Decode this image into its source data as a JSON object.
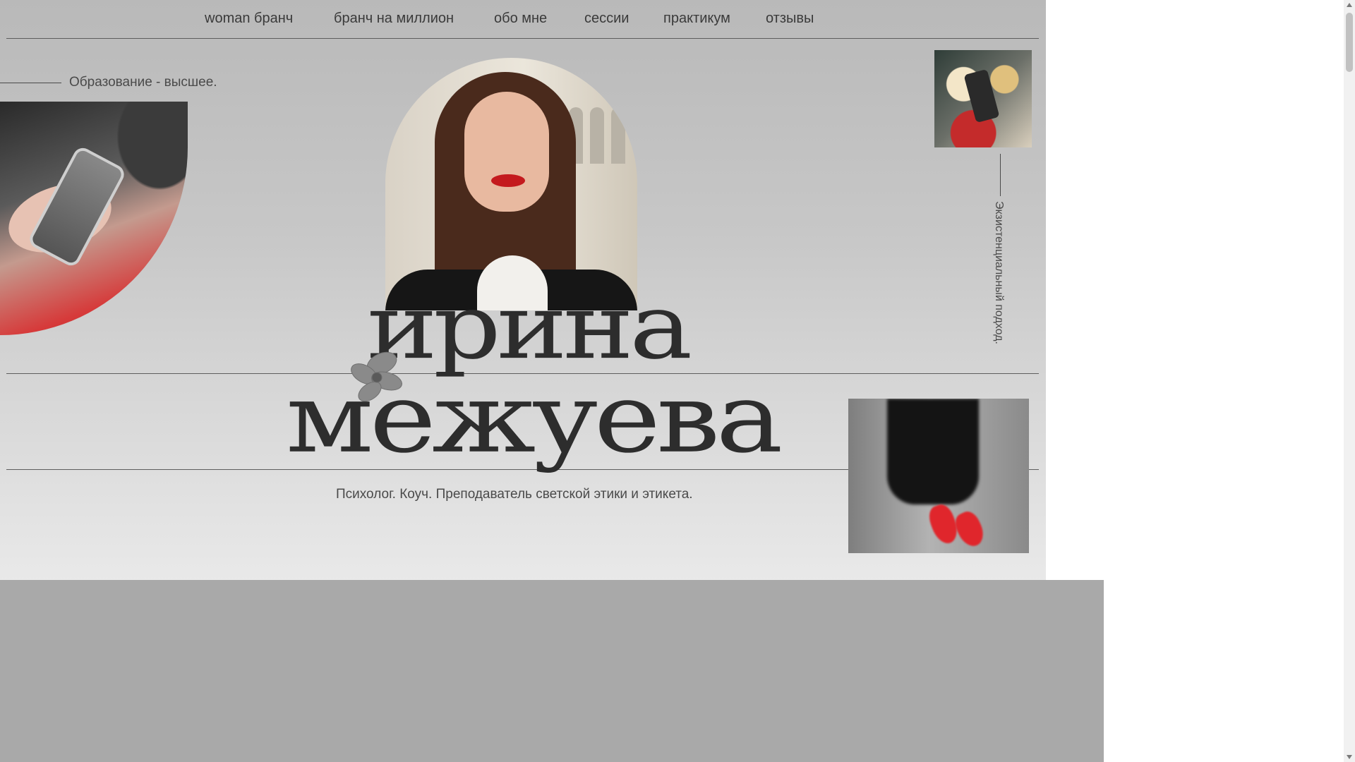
{
  "nav": {
    "items": [
      {
        "label": "woman бранч"
      },
      {
        "label": "бранч на миллион"
      },
      {
        "label": "обо мне"
      },
      {
        "label": "сессии"
      },
      {
        "label": "практикум"
      },
      {
        "label": "отзывы"
      }
    ]
  },
  "hero": {
    "education": "Образование - высшее.",
    "vertical_note": "Экзистенциальный подход.",
    "name_first": "ирина",
    "name_last": "межуева",
    "subtitle": "Психолог. Коуч. Преподаватель светской этики и этикета."
  },
  "colors": {
    "hero_bg": "#c7c7c7",
    "dark_arc": "#444444",
    "lower_bg": "#a9a9a9",
    "text": "#3a3a3a"
  }
}
